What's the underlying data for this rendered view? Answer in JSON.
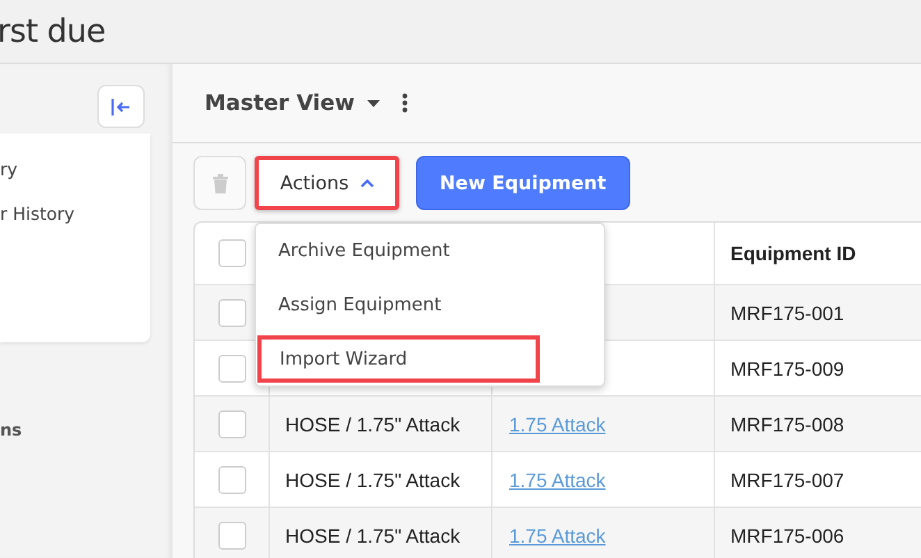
{
  "header": {
    "brand": "rst due"
  },
  "sidebar": {
    "items": [
      {
        "label": "ry"
      },
      {
        "label": "r History"
      }
    ],
    "section_label": "ns"
  },
  "view": {
    "title": "Master View"
  },
  "toolbar": {
    "actions": {
      "label": "Actions",
      "expanded": true,
      "highlighted": true
    },
    "new_button": "New Equipment"
  },
  "actions_menu": [
    {
      "label": "Archive Equipment",
      "highlighted": false
    },
    {
      "label": "Assign Equipment",
      "highlighted": false
    },
    {
      "label": "Import Wizard",
      "highlighted": true
    }
  ],
  "table": {
    "all_selected": false,
    "column_4": "Equipment ID",
    "rows": [
      {
        "selected": false,
        "equipment_id": "MRF175-001"
      },
      {
        "selected": false,
        "equipment_id": "MRF175-009"
      },
      {
        "selected": false,
        "column_2": "HOSE / 1.75\" Attack",
        "column_3": "1.75 Attack",
        "equipment_id": "MRF175-008"
      },
      {
        "selected": false,
        "column_2": "HOSE / 1.75\" Attack",
        "column_3": "1.75 Attack",
        "equipment_id": "MRF175-007"
      },
      {
        "selected": false,
        "column_2": "HOSE / 1.75\" Attack",
        "column_3": "1.75 Attack",
        "equipment_id": "MRF175-006"
      }
    ]
  }
}
